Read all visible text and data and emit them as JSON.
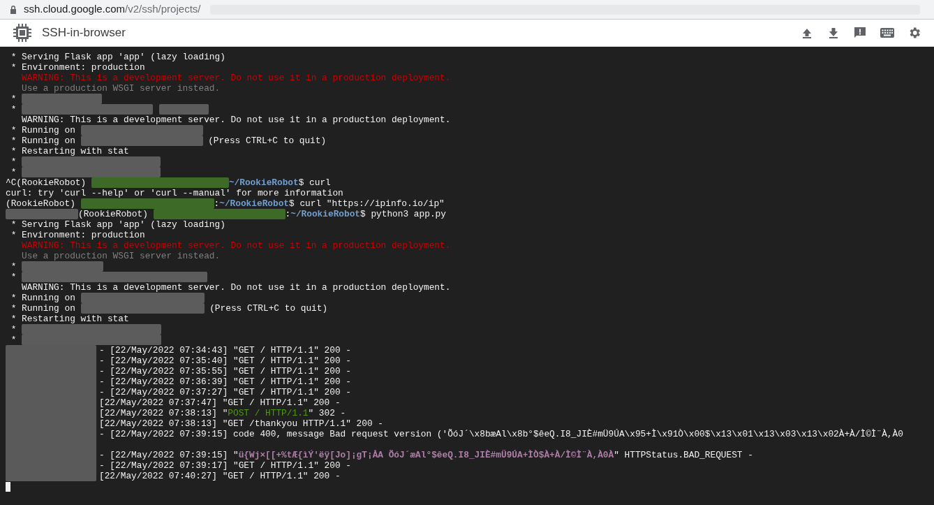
{
  "browser": {
    "url_host": "ssh.cloud.google.com",
    "url_path": "/v2/ssh/projects/"
  },
  "app": {
    "title": "SSH-in-browser"
  },
  "terminal": {
    "lines": [
      {
        "kind": "text",
        "segments": [
          {
            "kind": "output",
            "text": " * Serving Flask app 'app' (lazy loading)"
          }
        ]
      },
      {
        "kind": "text",
        "segments": [
          {
            "kind": "output",
            "text": " * Environment: production"
          }
        ]
      },
      {
        "kind": "text",
        "segments": [
          {
            "kind": "warning",
            "text": "   WARNING: This is a development server. Do not use it in a production deployment."
          }
        ]
      },
      {
        "kind": "text",
        "segments": [
          {
            "kind": "hint",
            "text": "   Use a production WSGI server instead."
          }
        ]
      },
      {
        "kind": "text",
        "segments": [
          {
            "kind": "output",
            "text": " * "
          },
          {
            "kind": "redacted"
          }
        ]
      },
      {
        "kind": "text",
        "segments": [
          {
            "kind": "output",
            "text": " * "
          },
          {
            "kind": "redacted"
          },
          {
            "kind": "redacted"
          }
        ]
      },
      {
        "kind": "text",
        "segments": [
          {
            "kind": "output",
            "text": "   WARNING: This is a development server. Do not use it in a production deployment."
          }
        ]
      },
      {
        "kind": "text",
        "segments": [
          {
            "kind": "output",
            "text": " * Running on "
          },
          {
            "kind": "redacted"
          }
        ]
      },
      {
        "kind": "text",
        "segments": [
          {
            "kind": "output",
            "text": " * Running on "
          },
          {
            "kind": "redacted"
          },
          {
            "kind": "output",
            "text": " (Press CTRL+C to quit)"
          }
        ]
      },
      {
        "kind": "text",
        "segments": [
          {
            "kind": "output",
            "text": " * Restarting with stat"
          }
        ]
      },
      {
        "kind": "text",
        "segments": [
          {
            "kind": "output",
            "text": " * "
          },
          {
            "kind": "redacted"
          }
        ]
      },
      {
        "kind": "text",
        "segments": [
          {
            "kind": "output",
            "text": " * "
          },
          {
            "kind": "redacted"
          }
        ]
      },
      {
        "kind": "text",
        "segments": [
          {
            "kind": "output",
            "text": "^C(RookieRobot) "
          },
          {
            "kind": "redacted-host"
          },
          {
            "kind": "path",
            "text": "~/RookieRobot"
          },
          {
            "kind": "output",
            "text": "$ curl"
          }
        ]
      },
      {
        "kind": "text",
        "segments": [
          {
            "kind": "output",
            "text": "curl: try 'curl --help' or 'curl --manual' for more information"
          }
        ]
      },
      {
        "kind": "text",
        "segments": [
          {
            "kind": "output",
            "text": "(RookieRobot) "
          },
          {
            "kind": "redacted-host"
          },
          {
            "kind": "output",
            "text": ":"
          },
          {
            "kind": "path",
            "text": "~/RookieRobot"
          },
          {
            "kind": "output",
            "text": "$ curl \"https://ipinfo.io/ip\""
          }
        ]
      },
      {
        "kind": "text",
        "segments": [
          {
            "kind": "redacted"
          },
          {
            "kind": "output",
            "text": "(RookieRobot) "
          },
          {
            "kind": "redacted-host"
          },
          {
            "kind": "output",
            "text": ":"
          },
          {
            "kind": "path",
            "text": "~/RookieRobot"
          },
          {
            "kind": "output",
            "text": "$ python3 app.py"
          }
        ]
      },
      {
        "kind": "text",
        "segments": [
          {
            "kind": "output",
            "text": " * Serving Flask app 'app' (lazy loading)"
          }
        ]
      },
      {
        "kind": "text",
        "segments": [
          {
            "kind": "output",
            "text": " * Environment: production"
          }
        ]
      },
      {
        "kind": "text",
        "segments": [
          {
            "kind": "warning",
            "text": "   WARNING: This is a development server. Do not use it in a production deployment."
          }
        ]
      },
      {
        "kind": "text",
        "segments": [
          {
            "kind": "hint",
            "text": "   Use a production WSGI server instead."
          }
        ]
      },
      {
        "kind": "text",
        "segments": [
          {
            "kind": "output",
            "text": " * "
          },
          {
            "kind": "redacted"
          }
        ]
      },
      {
        "kind": "text",
        "segments": [
          {
            "kind": "output",
            "text": " * "
          },
          {
            "kind": "redacted"
          }
        ]
      },
      {
        "kind": "text",
        "segments": [
          {
            "kind": "output",
            "text": "   WARNING: This is a development server. Do not use it in a production deployment."
          }
        ]
      },
      {
        "kind": "text",
        "segments": [
          {
            "kind": "output",
            "text": " * Running on "
          },
          {
            "kind": "redacted"
          }
        ]
      },
      {
        "kind": "text",
        "segments": [
          {
            "kind": "output",
            "text": " * Running on "
          },
          {
            "kind": "redacted"
          },
          {
            "kind": "output",
            "text": " (Press CTRL+C to quit)"
          }
        ]
      },
      {
        "kind": "text",
        "segments": [
          {
            "kind": "output",
            "text": " * Restarting with stat"
          }
        ]
      },
      {
        "kind": "text",
        "segments": [
          {
            "kind": "output",
            "text": " * "
          },
          {
            "kind": "redacted"
          }
        ]
      },
      {
        "kind": "text",
        "segments": [
          {
            "kind": "output",
            "text": " * "
          },
          {
            "kind": "redacted"
          }
        ]
      }
    ],
    "log_lines": [
      {
        "kind": "text",
        "segments": [
          {
            "kind": "output",
            "text": "- [22/May/2022 07:34:43] \"GET / HTTP/1.1\" 200 -"
          }
        ]
      },
      {
        "kind": "text",
        "segments": [
          {
            "kind": "output",
            "text": "- [22/May/2022 07:35:40] \"GET / HTTP/1.1\" 200 -"
          }
        ]
      },
      {
        "kind": "text",
        "segments": [
          {
            "kind": "output",
            "text": "- [22/May/2022 07:35:55] \"GET / HTTP/1.1\" 200 -"
          }
        ]
      },
      {
        "kind": "text",
        "segments": [
          {
            "kind": "output",
            "text": "- [22/May/2022 07:36:39] \"GET / HTTP/1.1\" 200 -"
          }
        ]
      },
      {
        "kind": "text",
        "segments": [
          {
            "kind": "output",
            "text": "- [22/May/2022 07:37:27] \"GET / HTTP/1.1\" 200 -"
          }
        ]
      },
      {
        "kind": "text",
        "segments": [
          {
            "kind": "output",
            "text": "[22/May/2022 07:37:47] \"GET / HTTP/1.1\" 200 -"
          }
        ]
      },
      {
        "kind": "text",
        "segments": [
          {
            "kind": "output",
            "text": "[22/May/2022 07:38:13] \""
          },
          {
            "kind": "request",
            "text": "POST / HTTP/1.1"
          },
          {
            "kind": "output",
            "text": "\" 302 -"
          }
        ]
      },
      {
        "kind": "text",
        "segments": [
          {
            "kind": "output",
            "text": "[22/May/2022 07:38:13] \"GET /thankyou HTTP/1.1\" 200 -"
          }
        ]
      },
      {
        "kind": "text",
        "segments": [
          {
            "kind": "output",
            "text": "- [22/May/2022 07:39:15] code 400, message Bad request version ('ÕóJ´\\x8bæAl\\x8b°$êeQ.I8_JIÈ#mÜ9ÚA\\x95+Ì\\x91Ò\\x00$\\x13\\x01\\x13\\x03\\x13\\x02À+À/Ì©Ì¨À,À0"
          }
        ]
      },
      {
        "kind": "blank"
      },
      {
        "kind": "text",
        "segments": [
          {
            "kind": "output",
            "text": "- [22/May/2022 07:39:15] \""
          },
          {
            "kind": "payload",
            "text": "ü{Wj×[[+%tÆ{ìÝ'ëÿ[Jo]¡gT¡ÅA ÕóJ´æAl°$êeQ.I8_JIÈ#mÜ9ÚA+ÌÒ$À+À/Ì©Ì¨À,À0À"
          },
          {
            "kind": "output",
            "text": "\" HTTPStatus.BAD_REQUEST -"
          }
        ]
      },
      {
        "kind": "text",
        "segments": [
          {
            "kind": "output",
            "text": "- [22/May/2022 07:39:17] \"GET / HTTP/1.1\" 200 -"
          }
        ]
      },
      {
        "kind": "text",
        "segments": [
          {
            "kind": "output",
            "text": "[22/May/2022 07:40:27] \"GET / HTTP/1.1\" 200 -"
          }
        ]
      }
    ],
    "cursor": true
  }
}
